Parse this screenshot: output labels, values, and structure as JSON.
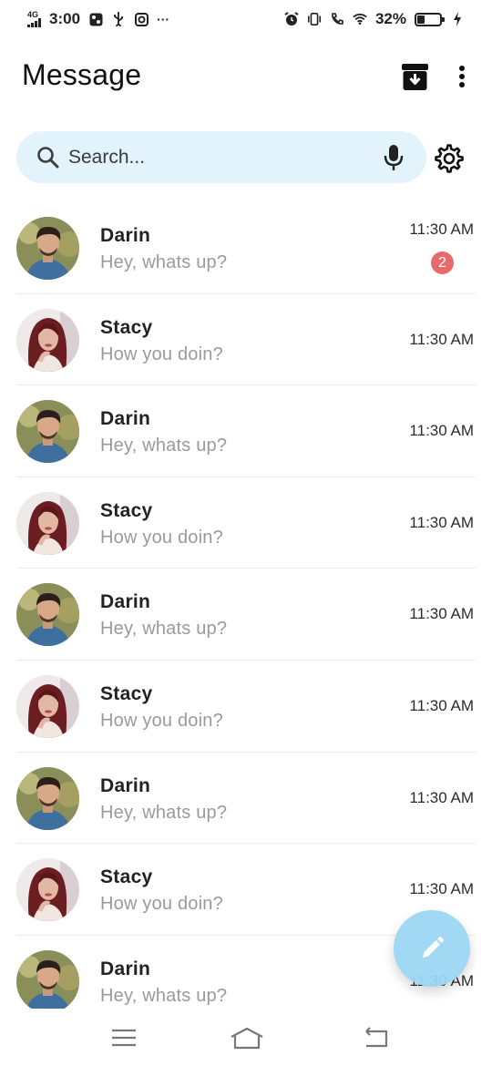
{
  "status_bar": {
    "network": "4G",
    "time": "3:00",
    "notification_more": "···",
    "battery_percent": "32%",
    "battery_level": 0.32
  },
  "app_bar": {
    "title": "Message",
    "archive_icon": "archive-icon",
    "menu_icon": "more-vert-icon"
  },
  "search": {
    "placeholder": "Search...",
    "value": "",
    "icon": "search-icon",
    "mic_icon": "mic-icon",
    "settings_icon": "gear-icon"
  },
  "conversations": [
    {
      "name": "Darin",
      "preview": "Hey, whats up?",
      "time": "11:30 AM",
      "unread": "2",
      "avatar": "male-avatar"
    },
    {
      "name": "Stacy",
      "preview": "How you doin?",
      "time": "11:30 AM",
      "unread": "",
      "avatar": "female-avatar"
    },
    {
      "name": "Darin",
      "preview": "Hey, whats up?",
      "time": "11:30 AM",
      "unread": "",
      "avatar": "male-avatar"
    },
    {
      "name": "Stacy",
      "preview": "How you doin?",
      "time": "11:30 AM",
      "unread": "",
      "avatar": "female-avatar"
    },
    {
      "name": "Darin",
      "preview": "Hey, whats up?",
      "time": "11:30 AM",
      "unread": "",
      "avatar": "male-avatar"
    },
    {
      "name": "Stacy",
      "preview": "How you doin?",
      "time": "11:30 AM",
      "unread": "",
      "avatar": "female-avatar"
    },
    {
      "name": "Darin",
      "preview": "Hey, whats up?",
      "time": "11:30 AM",
      "unread": "",
      "avatar": "male-avatar"
    },
    {
      "name": "Stacy",
      "preview": "How you doin?",
      "time": "11:30 AM",
      "unread": "",
      "avatar": "female-avatar"
    },
    {
      "name": "Darin",
      "preview": "Hey, whats up?",
      "time": "11:30 AM",
      "unread": "",
      "avatar": "male-avatar"
    }
  ],
  "fab": {
    "icon": "pencil-icon"
  },
  "nav_bar": {
    "menu_icon": "menu-icon",
    "home_icon": "home-icon",
    "back_icon": "back-icon"
  },
  "colors": {
    "search_bg": "#e2f3fc",
    "badge": "#e86a6a",
    "fab": "#9dd6f3",
    "preview_text": "#9a9a9a"
  }
}
